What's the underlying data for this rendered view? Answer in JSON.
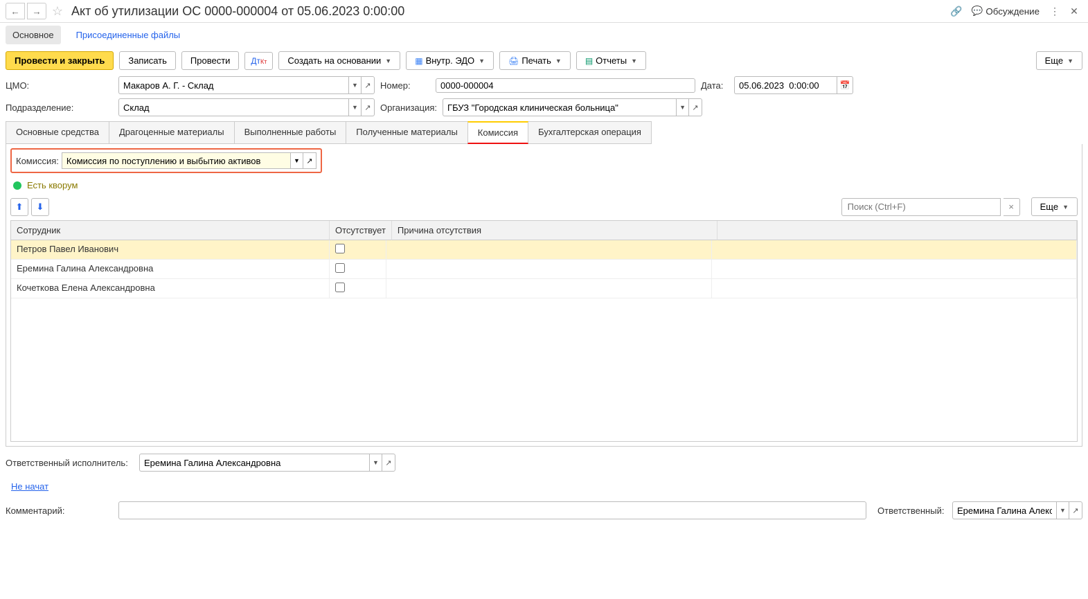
{
  "title": "Акт об утилизации ОС 0000-000004 от 05.06.2023 0:00:00",
  "discussLabel": "Обсуждение",
  "subnav": {
    "main": "Основное",
    "files": "Присоединенные файлы"
  },
  "toolbar": {
    "postClose": "Провести и закрыть",
    "save": "Записать",
    "post": "Провести",
    "createBased": "Создать на основании",
    "edo": "Внутр. ЭДО",
    "print": "Печать",
    "reports": "Отчеты",
    "more": "Еще"
  },
  "fields": {
    "cmoLabel": "ЦМО:",
    "cmoValue": "Макаров А. Г. - Склад",
    "numberLabel": "Номер:",
    "numberValue": "0000-000004",
    "dateLabel": "Дата:",
    "dateValue": "05.06.2023  0:00:00",
    "deptLabel": "Подразделение:",
    "deptValue": "Склад",
    "orgLabel": "Организация:",
    "orgValue": "ГБУЗ \"Городская клиническая больница\""
  },
  "tabs": {
    "os": "Основные средства",
    "precious": "Драгоценные материалы",
    "works": "Выполненные работы",
    "received": "Полученные материалы",
    "commission": "Комиссия",
    "accounting": "Бухгалтерская операция"
  },
  "commission": {
    "label": "Комиссия:",
    "value": "Комиссия по поступлению и выбытию активов",
    "quorum": "Есть кворум",
    "searchPlaceholder": "Поиск (Ctrl+F)",
    "more": "Еще",
    "columns": {
      "employee": "Сотрудник",
      "absent": "Отсутствует",
      "reason": "Причина отсутствия"
    },
    "rows": [
      {
        "name": "Петров Павел Иванович",
        "absent": false,
        "reason": ""
      },
      {
        "name": "Еремина Галина Александровна",
        "absent": false,
        "reason": ""
      },
      {
        "name": "Кочеткова Елена Александровна",
        "absent": false,
        "reason": ""
      }
    ]
  },
  "footer": {
    "executorLabel": "Ответственный исполнитель:",
    "executorValue": "Еремина Галина Александровна",
    "notStarted": "Не начат",
    "commentLabel": "Комментарий:",
    "responsibleLabel": "Ответственный:",
    "responsibleValue": "Еремина Галина Алексан"
  }
}
